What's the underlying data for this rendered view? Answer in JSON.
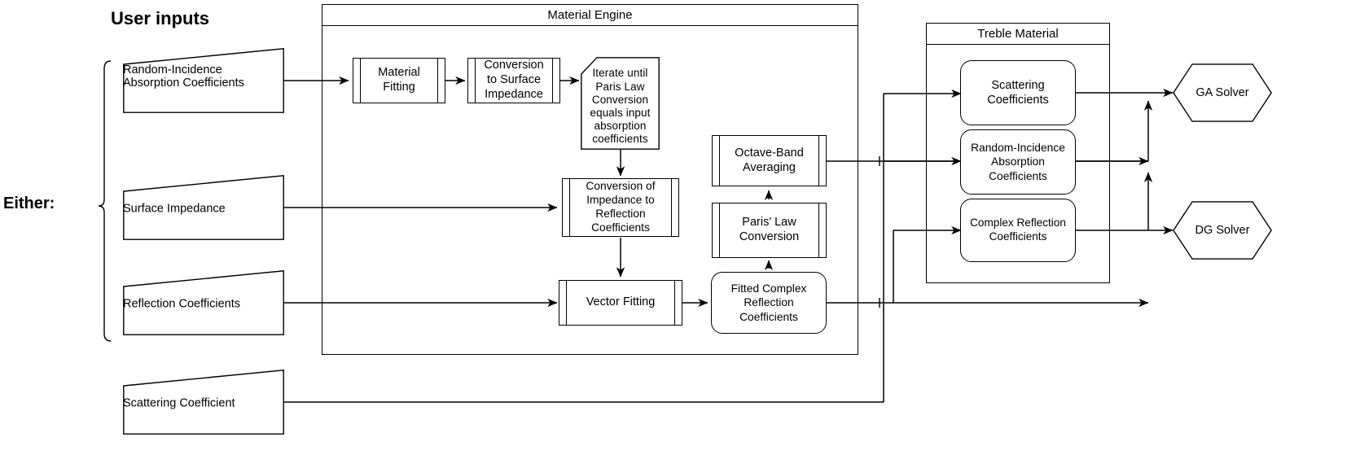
{
  "diagram": {
    "title_user_inputs": "User inputs",
    "label_either": "Either:",
    "groups": {
      "material_engine": "Material Engine",
      "treble_material": "Treble Material"
    },
    "inputs": [
      {
        "name": "random-incidence-absorption-coefficients",
        "label": "Random-Incidence\nAbsorption Coefficients"
      },
      {
        "name": "surface-impedance",
        "label": "Surface Impedance"
      },
      {
        "name": "reflection-coefficients",
        "label": "Reflection Coefficients"
      },
      {
        "name": "scattering-coefficient",
        "label": "Scattering Coefficient"
      }
    ],
    "input_labels": {
      "random_incidence_absorption_line1": "Random-Incidence",
      "random_incidence_absorption_line2": "Absorption Coefficients",
      "surface_impedance": "Surface Impedance",
      "reflection_coefficients": "Reflection Coefficients",
      "scattering_coefficient": "Scattering Coefficient"
    },
    "engine_nodes": {
      "material_fitting": "Material\nFitting",
      "conversion_to_surface_impedance": "Conversion\nto Surface\nImpedance",
      "iterate_until": "Iterate until\nParis Law\nConversion\nequals input\nabsorption\ncoefficients",
      "conversion_impedance_to_reflection": "Conversion of\nImpedance to\nReflection\nCoefficients",
      "vector_fitting": "Vector Fitting",
      "octave_band_averaging": "Octave-Band\nAveraging",
      "paris_law_conversion": "Paris' Law\nConversion",
      "fitted_complex_reflection_coefficients": "Fitted Complex\nReflection\nCoefficients"
    },
    "treble_nodes": {
      "scattering_coefficients": "Scattering\nCoefficients",
      "random_incidence_absorption_coefficients": "Random-Incidence\nAbsorption\nCoefficients",
      "complex_reflection_coefficients": "Complex Reflection\nCoefficients"
    },
    "solvers": {
      "ga_solver": "GA Solver",
      "dg_solver": "DG Solver"
    },
    "colors": {
      "stroke": "#000000",
      "background": "#ffffff",
      "text": "#000000"
    }
  }
}
